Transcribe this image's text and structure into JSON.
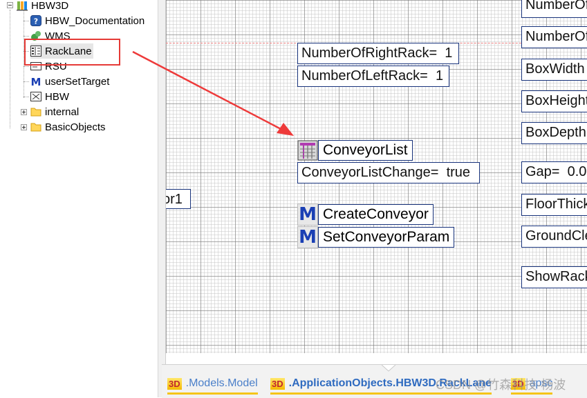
{
  "tree": {
    "root": "HBW3D",
    "items": [
      {
        "label": "HBW_Documentation",
        "icon": "help-icon"
      },
      {
        "label": "WMS",
        "icon": "wms-icon"
      },
      {
        "label": "RackLane",
        "icon": "class-grid-icon"
      },
      {
        "label": "RSU",
        "icon": "class-icon"
      },
      {
        "label": "userSetTarget",
        "icon": "method-icon"
      },
      {
        "label": "HBW",
        "icon": "class-icon"
      },
      {
        "label": "internal",
        "icon": "folder-icon"
      },
      {
        "label": "BasicObjects",
        "icon": "folder-icon"
      }
    ]
  },
  "canvas": {
    "boxes": [
      {
        "id": "right",
        "text": "NumberOfRightRack=  1"
      },
      {
        "id": "left",
        "text": "NumberOfLeftRack=  1"
      },
      {
        "id": "change",
        "text": "ConveyorListChange=  true"
      },
      {
        "id": "or1",
        "text": "or1"
      }
    ],
    "objects": [
      {
        "label": "ConveyorList",
        "icon": "table-icon"
      },
      {
        "label": "CreateConveyor",
        "icon": "method-icon",
        "badge": "M"
      },
      {
        "label": "SetConveyorParam",
        "icon": "method-icon",
        "badge": "M"
      }
    ],
    "right_column": [
      "NumberOf",
      "NumberOf",
      "BoxWidth",
      "BoxHeight",
      "BoxDepth",
      "Gap=  0.0",
      "FloorThick",
      "GroundCle",
      "ShowRack"
    ]
  },
  "tabs": [
    {
      "icon_text": "3D",
      "label": ".Models.Model"
    },
    {
      "icon_text": "3D",
      "label": ".ApplicationObjects.HBW3D.RackLane"
    },
    {
      "icon_text": "3D",
      "label": "apsc"
    }
  ],
  "watermark": "CSDN @竹森科技-杨波",
  "colors": {
    "accent": "#16317a",
    "highlight": "#e53935",
    "tab_text": "#4a7fc9"
  }
}
